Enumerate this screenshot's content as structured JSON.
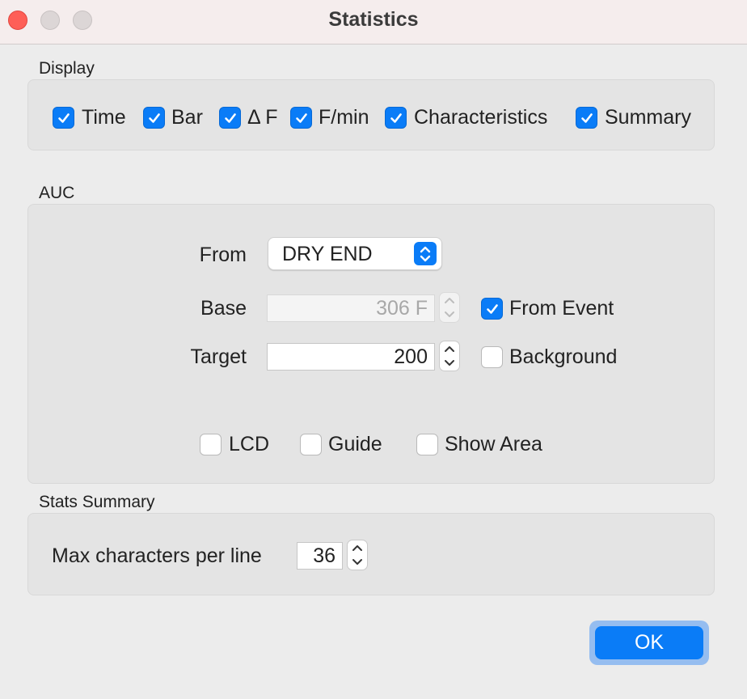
{
  "window": {
    "title": "Statistics"
  },
  "display": {
    "label": "Display",
    "items": [
      {
        "label": "Time",
        "checked": true
      },
      {
        "label": "Bar",
        "checked": true
      },
      {
        "label": "Δ F",
        "checked": true
      },
      {
        "label": "F/min",
        "checked": true
      },
      {
        "label": "Characteristics",
        "checked": true
      },
      {
        "label": "Summary",
        "checked": true
      }
    ]
  },
  "auc": {
    "label": "AUC",
    "from_label": "From",
    "from_value": "DRY END",
    "base_label": "Base",
    "base_value": "306 F",
    "target_label": "Target",
    "target_value": "200",
    "from_event": {
      "label": "From Event",
      "checked": true
    },
    "background": {
      "label": "Background",
      "checked": false
    },
    "lcd": {
      "label": "LCD",
      "checked": false
    },
    "guide": {
      "label": "Guide",
      "checked": false
    },
    "show_area": {
      "label": "Show Area",
      "checked": false
    }
  },
  "stats_summary": {
    "label": "Stats Summary",
    "max_chars_label": "Max characters per line",
    "max_chars_value": "36"
  },
  "ok_label": "OK",
  "colors": {
    "accent": "#0a7cf7",
    "close": "#fe5f57"
  }
}
